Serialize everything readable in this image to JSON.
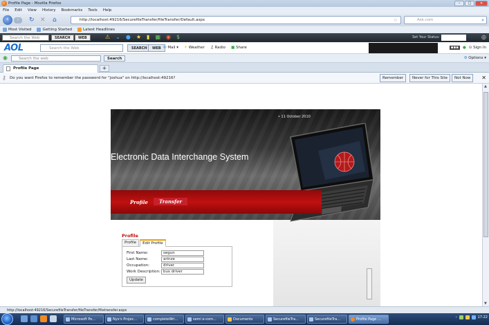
{
  "window": {
    "title": "Profile Page - Mozilla Firefox"
  },
  "menu": [
    "File",
    "Edit",
    "View",
    "History",
    "Bookmarks",
    "Tools",
    "Help"
  ],
  "nav": {
    "url": "http://localhost:49216/SecurefileTransfer/fileTransfer/Default.aspx",
    "search_placeholder": "Ask.com"
  },
  "bookmarks": [
    "Most Visited",
    "Getting Started",
    "Latest Headlines"
  ],
  "toolbar1": {
    "search_placeholder": "Search the Web",
    "search_btn": "SEARCH",
    "web_btn": "WEB",
    "status_label": "Set Your Status:"
  },
  "toolbar2": {
    "logo": "AOL",
    "search_placeholder": "Search the Web",
    "search_btn": "SEARCH",
    "web_btn": "WEB",
    "links": [
      "Mail",
      "Weather",
      "Radio",
      "Share"
    ],
    "sign_in": "Sign In"
  },
  "toolbar3": {
    "search_placeholder": "Search the web",
    "search_btn": "Search",
    "options": "Options"
  },
  "tabs": [
    {
      "label": "Profile Page"
    }
  ],
  "password_bar": {
    "message": "Do you want Firefox to remember the password for \"joshua\" on http://localhost:49216?",
    "remember": "Remember",
    "never": "Never for This Site",
    "not_now": "Not Now"
  },
  "site": {
    "date": "• 11 October 2010",
    "title": "Electronic Data Interchange System",
    "nav": [
      "Profile",
      "Transfer"
    ],
    "profile": {
      "heading": "Profile",
      "tabs": [
        "Profile",
        "Edit Profile"
      ],
      "fields": [
        {
          "label": "First Name:",
          "value": "segun"
        },
        {
          "label": "Last Name:",
          "value": "arinze"
        },
        {
          "label": "Occupation:",
          "value": "driver"
        },
        {
          "label": "Work Description:",
          "value": "bus driver"
        }
      ],
      "update": "Update"
    }
  },
  "status": {
    "text": "http://localhost:49216/SecurefileTransfer/fileTransfer/filetransfer.aspx"
  },
  "taskbar": {
    "tasks": [
      "Microsoft Po...",
      "Nyx's Projec...",
      "completeWri...",
      "semi e-com...",
      "Documents",
      "SecurefileTra...",
      "SecurefileTra...",
      "Profile Page ..."
    ],
    "clock": "17:22"
  }
}
